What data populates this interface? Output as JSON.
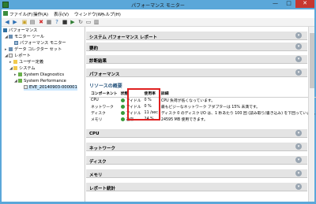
{
  "window": {
    "title": "パフォーマンス モニター",
    "minimize": "—",
    "maximize": "□",
    "close": "✕"
  },
  "menu": {
    "items": [
      "ファイル(F)",
      "操作(A)",
      "表示(V)",
      "ウィンドウ(W)",
      "ヘルプ(H)"
    ]
  },
  "toolbar": {
    "icons": [
      "back-arrow-icon",
      "forward-arrow-icon",
      "folder-up-icon",
      "show-hide-tree-icon",
      "delete-icon",
      "properties-icon",
      "help-icon",
      "stop-icon",
      "start-icon",
      "refresh-icon",
      "export-icon",
      "report-icon"
    ]
  },
  "tree": {
    "root": "パフォーマンス",
    "monitor_tools": "モニター ツール",
    "perf_monitor": "パフォーマンス モニター",
    "data_collector_sets": "データ コレクター セット",
    "reports": "レポート",
    "user_defined": "ユーザー定義",
    "system": "システム",
    "system_diagnostics": "System Diagnostics",
    "system_performance": "System Performance",
    "report_item": "EVE_20140903-000001"
  },
  "report": {
    "sections": {
      "system_perf_report": "システム パフォーマンス レポート",
      "summary": "要約",
      "diagnostic_results": "診断結果",
      "performance": "パフォーマンス",
      "cpu": "CPU",
      "network": "ネットワーク",
      "disk": "ディスク",
      "memory": "メモリ",
      "report_stats": "レポート統計"
    },
    "resource_overview_title": "リソースの概要",
    "table": {
      "headers": {
        "component": "コンポーネント",
        "status": "状態",
        "usage": "使用率",
        "details": "詳細"
      },
      "rows": [
        {
          "component": "CPU",
          "status": "アイドル",
          "usage": "0 %",
          "details": "CPU 負荷が低くなっています。",
          "status_color": "#3a9b3a"
        },
        {
          "component": "ネットワーク",
          "status": "アイドル",
          "usage": "0 %",
          "details": "最もビジーなネットワーク アダプターは 15% 未満です。",
          "status_color": "#3a9b3a"
        },
        {
          "component": "ディスク",
          "status": "アイドル",
          "usage": "11 /sec",
          "details": "ディスク 0 のディスク I/O は、1 秒あたり 100 回 (読み取り/書き込み) を下回っています。",
          "status_color": "#3a9b3a"
        },
        {
          "component": "メモリ",
          "status": "通常",
          "usage": "24 %",
          "details": "24595 MB 使用できます。",
          "status_color": "#3a9b3a"
        }
      ]
    },
    "collapse_symbol": "▾"
  },
  "colors": {
    "titlebar": "#5ba7d9",
    "highlight_box": "#e02020",
    "status_ok": "#3a9b3a"
  }
}
